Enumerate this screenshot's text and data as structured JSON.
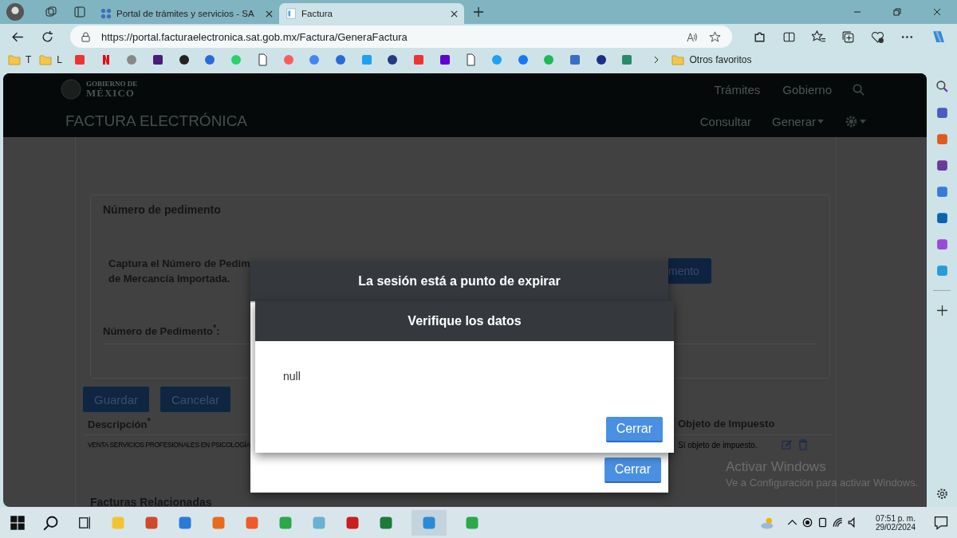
{
  "browser": {
    "tabs": [
      {
        "title": "Portal de trámites y servicios - SA",
        "selected": false
      },
      {
        "title": "Factura",
        "selected": true
      }
    ],
    "url": "https://portal.facturaelectronica.sat.gob.mx/Factura/GeneraFactura",
    "bookmark_folders": [
      {
        "label": "T"
      },
      {
        "label": "L"
      }
    ],
    "other_favorites": "Otros favoritos"
  },
  "header": {
    "logo_line_1": "GOBIERNO DE",
    "logo_line_2": "MÉXICO",
    "top_nav": [
      "Trámites",
      "Gobierno"
    ],
    "title": "FACTURA ELECTRÓNICA",
    "nav": [
      "Consultar",
      "Generar"
    ]
  },
  "form": {
    "section_title": "Número de pedimento",
    "instructions": [
      "Captura el Número de Pedim",
      "de Mercancía Importada."
    ],
    "add_button": "mento",
    "field_label": "Número de Pedimento$^{*}$:",
    "buttons": [
      "Guardar",
      "Cancelar"
    ],
    "table": {
      "columns": [
        "Descripción$^{*}$",
        "Objeto de Impuesto"
      ],
      "rows": [
        [
          "VENTA SERVICIOS PROFESIONALES EN PSICOLOGÍA",
          "Sí objeto de impuesto."
        ]
      ]
    },
    "next_section_title": "Facturas Relacionadas"
  },
  "session_dialog": {
    "title": "La sesión está a punto de expirar",
    "button": "Cerrar"
  },
  "error_dialog": {
    "title": "Verifique los datos",
    "message": "null",
    "button": "Cerrar"
  },
  "activation_notice": {
    "title": "Activar Windows",
    "message": "Ve a Configuración para activar Windows."
  },
  "taskbar": {
    "time": "07:51 p. m.",
    "date": "29/02/2024"
  }
}
